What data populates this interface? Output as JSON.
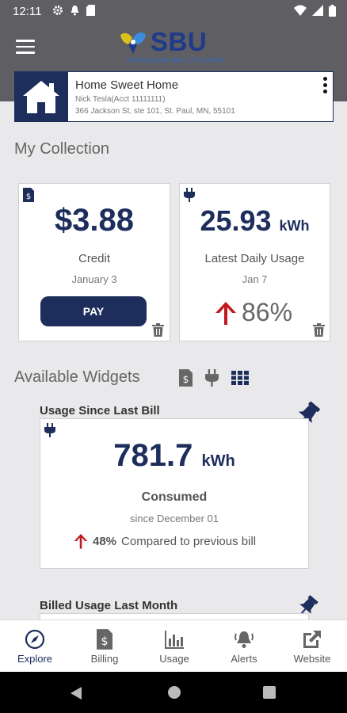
{
  "status_bar": {
    "time": "12:11"
  },
  "header": {
    "logo_text": "SBU",
    "logo_subtitle": "STURGEON BAY UTILITIES"
  },
  "account": {
    "name": "Home Sweet Home",
    "holder": "Nick Tesla(Acct 11111111)",
    "address": "366 Jackson St, ste 101, St. Paul, MN, 55101"
  },
  "collection": {
    "title": "My Collection",
    "credit": {
      "amount": "$3.88",
      "label": "Credit",
      "date": "January 3",
      "pay_label": "PAY"
    },
    "usage": {
      "value": "25.93",
      "unit": "kWh",
      "label": "Latest Daily Usage",
      "date": "Jan 7",
      "percent": "86%"
    }
  },
  "widgets": {
    "title": "Available Widgets",
    "since_bill": {
      "title": "Usage Since Last Bill",
      "value": "781.7",
      "unit": "kWh",
      "label": "Consumed",
      "since": "since December 01",
      "compare_pct": "48%",
      "compare_text": "Compared to previous bill"
    },
    "last_month": {
      "title": "Billed Usage Last Month"
    }
  },
  "bottom_nav": [
    {
      "label": "Explore",
      "icon": "compass-icon"
    },
    {
      "label": "Billing",
      "icon": "bill-icon"
    },
    {
      "label": "Usage",
      "icon": "bar-chart-icon"
    },
    {
      "label": "Alerts",
      "icon": "bell-icon"
    },
    {
      "label": "Website",
      "icon": "external-link-icon"
    }
  ],
  "colors": {
    "navy": "#1d2d5c",
    "header_gray": "#5e5e63",
    "up_arrow_red": "#c0181f"
  }
}
